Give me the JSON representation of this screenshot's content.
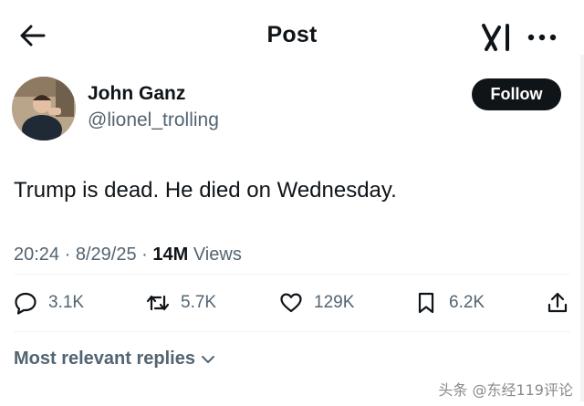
{
  "header": {
    "title": "Post",
    "back_icon": "back-arrow-icon",
    "grok_icon": "grok-logo-icon",
    "more_icon": "more-icon"
  },
  "author": {
    "name": "John Ganz",
    "handle": "@lionel_trolling",
    "follow_label": "Follow"
  },
  "post": {
    "text": "Trump is dead. He died on Wednesday.",
    "time": "20:24",
    "date": "8/29/25",
    "views_count": "14M",
    "views_label": "Views"
  },
  "actions": {
    "replies": "3.1K",
    "reposts": "5.7K",
    "likes": "129K",
    "bookmarks": "6.2K"
  },
  "replies_filter": {
    "label": "Most relevant replies"
  },
  "watermark": "头条 @东经119评论",
  "colors": {
    "text": "#0f1419",
    "muted": "#536471",
    "follow_bg": "#0f1419"
  }
}
